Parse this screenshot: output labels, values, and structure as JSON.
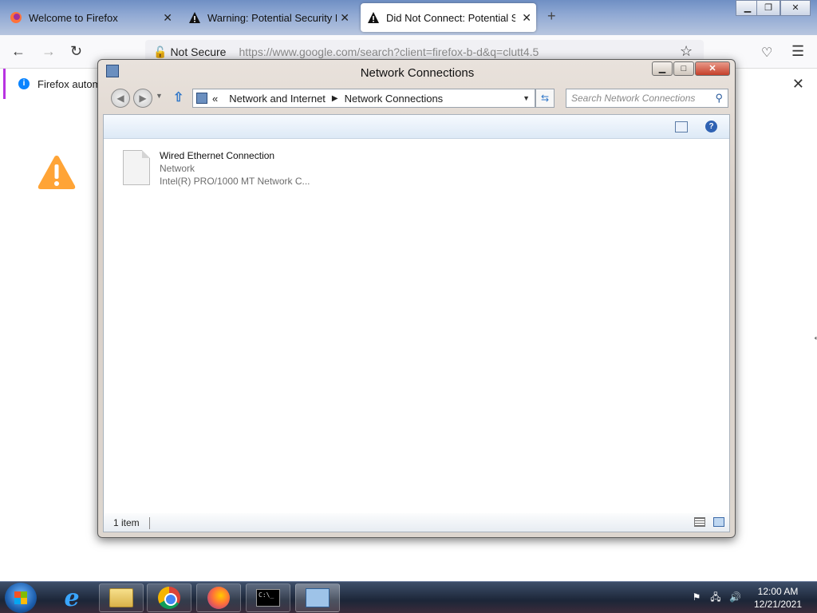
{
  "browser": {
    "tabs": [
      {
        "label": "Welcome to Firefox",
        "icon": "firefox-icon"
      },
      {
        "label": "Warning: Potential Security Risk",
        "icon": "warning-icon"
      },
      {
        "label": "Did Not Connect: Potential Sec",
        "icon": "warning-icon",
        "active": true
      }
    ],
    "tab_close": "✕",
    "new_tab": "+",
    "not_secure_label": "Not Secure",
    "url": "https://www.google.com/search?client=firefox-b-d&q=clutt4.5",
    "notification_text": "Firefox automa",
    "accent_color": "#b833e1",
    "warning_color": "#ffa436"
  },
  "window": {
    "title": "Network Connections",
    "breadcrumb": [
      "Network and Internet",
      "Network Connections"
    ],
    "breadcrumb_prefix": "«",
    "search_placeholder": "Search Network Connections",
    "item": {
      "name": "Wired Ethernet Connection",
      "type": "Network",
      "device": "Intel(R) PRO/1000 MT Network C..."
    },
    "status": "1 item"
  },
  "taskbar": {
    "apps": [
      "start-button",
      "internet-explorer",
      "windows-explorer",
      "chrome",
      "firefox",
      "command-prompt",
      "network-connections"
    ],
    "cmd_text": "C:\\_",
    "time": "12:00 AM",
    "date": "12/21/2021"
  }
}
